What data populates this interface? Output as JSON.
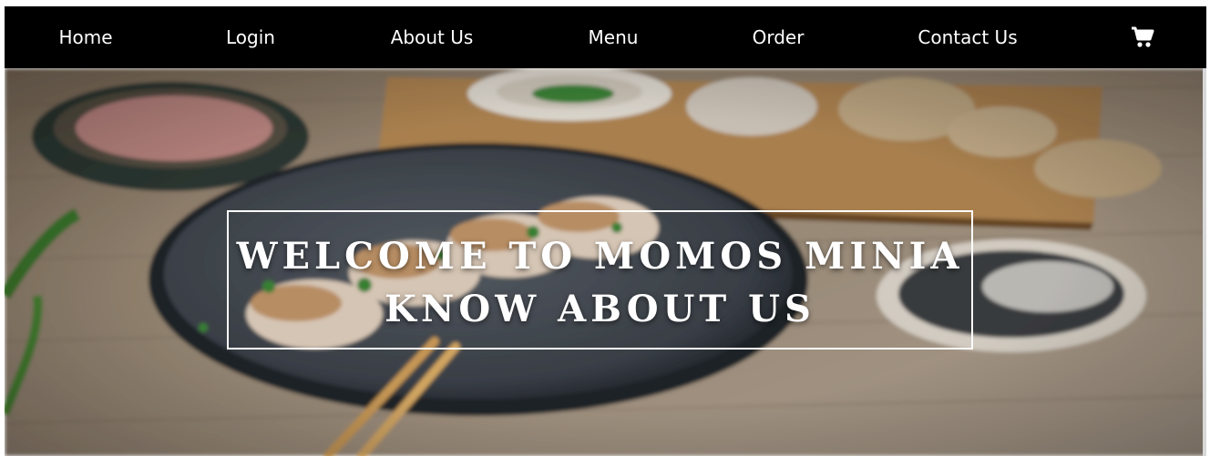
{
  "navbar": {
    "items": [
      {
        "label": "Home"
      },
      {
        "label": "Login"
      },
      {
        "label": "About Us"
      },
      {
        "label": "Menu"
      },
      {
        "label": "Order"
      },
      {
        "label": "Contact Us"
      }
    ],
    "cart_icon": "shopping-cart-icon",
    "background": "#000000",
    "text_color": "#ffffff"
  },
  "hero": {
    "line1": "WELCOME TO MOMOS MINIA",
    "line2": "KNOW ABOUT US",
    "image": "blurred photo of momos on a dark plate with chopsticks, ginger, dipping sauce and greens on a wooden table"
  }
}
